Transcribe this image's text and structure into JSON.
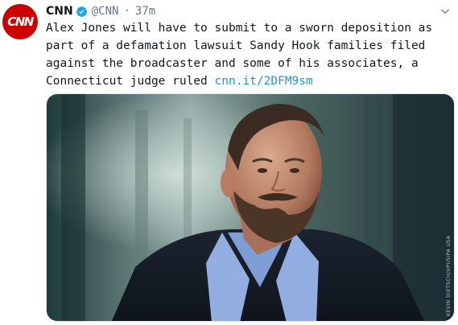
{
  "tweet": {
    "author_name": "CNN",
    "handle": "@CNN",
    "separator": "·",
    "timestamp": "37m",
    "body": "Alex Jones will have to submit to a sworn deposition as part of a defamation lawsuit Sandy Hook families filed against the broadcaster and some of his associates, a Connecticut judge ruled",
    "link_text": "cnn.it/2DFM9sm"
  },
  "avatar": {
    "text": "CNN"
  },
  "media": {
    "credit": "KEVIN DIETSCH/UPI/SIPA USA"
  },
  "icons": {
    "verified": "verified-badge-icon",
    "more": "chevron-down-icon"
  },
  "colors": {
    "brand_red": "#cc0000",
    "link_blue": "#1b95e0",
    "muted": "#657786",
    "verified_blue": "#1da1f2"
  }
}
